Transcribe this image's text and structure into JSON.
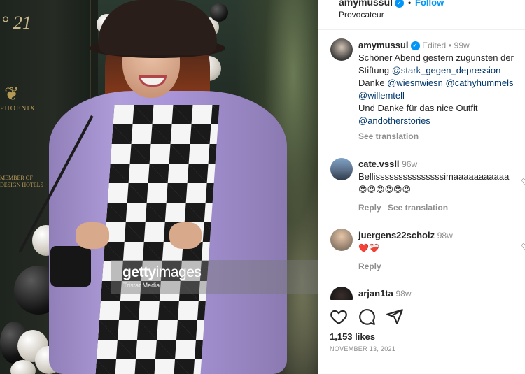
{
  "post": {
    "photo_watermark": {
      "brand_bold": "getty",
      "brand_light": "images",
      "credit": "Tristar Media"
    },
    "wall_text": {
      "number": "° 21",
      "logo": "PHOENIX",
      "member": "MEMBER OF\nDESIGN HOTELS"
    }
  },
  "header": {
    "username": "amymussul",
    "follow_label": "Follow",
    "subtitle": "Provocateur"
  },
  "caption": {
    "username": "amymussul",
    "edited_label": "Edited",
    "time": "99w",
    "lines": [
      "Schöner Abend gestern zugunsten der",
      "Stiftung",
      "@stark_gegen_depression",
      "Danke",
      "@wiesnwiesn",
      "@cathyhummels",
      "@willemtell",
      "Und Danke für das nice Outfit",
      "@andotherstories"
    ],
    "see_translation": "See translation"
  },
  "comments": [
    {
      "username": "cate.vssll",
      "time": "96w",
      "text": "Bellisssssssssssssssimaaaaaaaaaaa",
      "emojis": "😍😍😍😍😍😍",
      "reply_label": "Reply",
      "translation_label": "See translation"
    },
    {
      "username": "juergens22scholz",
      "time": "98w",
      "emojis": "❤️❤️‍🩹",
      "reply_label": "Reply"
    },
    {
      "username": "arjan1ta",
      "time": "98w"
    }
  ],
  "footer": {
    "likes": "1,153 likes",
    "date": "NOVEMBER 13, 2021"
  },
  "colors": {
    "accent_blue": "#0095f6",
    "mention_blue": "#00376b",
    "secondary_text": "#8e8e8e",
    "coat_lavender": "#a995d8"
  },
  "icons": [
    "verified-badge-icon",
    "heart-icon",
    "comment-icon",
    "share-icon"
  ]
}
